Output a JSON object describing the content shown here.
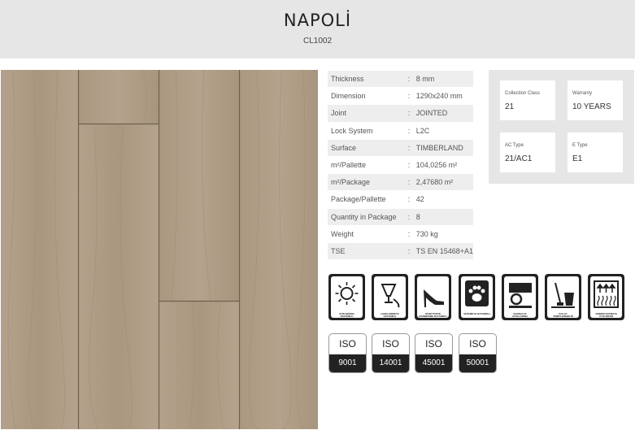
{
  "header": {
    "title": "NAPOLİ",
    "code": "CL1002"
  },
  "specs": [
    {
      "label": "Thickness",
      "sep": ":",
      "value": "8 mm"
    },
    {
      "label": "Dimension",
      "sep": ":",
      "value": "1290x240 mm"
    },
    {
      "label": "Joint",
      "sep": ":",
      "value": "JOINTED"
    },
    {
      "label": "Lock System",
      "sep": ":",
      "value": "L2C"
    },
    {
      "label": "Surface",
      "sep": ":",
      "value": "TIMBERLAND"
    },
    {
      "label": "m²/Pallette",
      "sep": ":",
      "value": "104,0256 m²"
    },
    {
      "label": "m²/Package",
      "sep": ":",
      "value": "2,47680 m²"
    },
    {
      "label": "Package/Pallette",
      "sep": ":",
      "value": "42"
    },
    {
      "label": "Quantity in Package",
      "sep": ":",
      "value": "8"
    },
    {
      "label": "Weight",
      "sep": ":",
      "value": "730 kg"
    },
    {
      "label": "TSE",
      "sep": ":",
      "value": "TS EN 15468+A1"
    }
  ],
  "info_cards": [
    {
      "label": "Collection Class",
      "value": "21"
    },
    {
      "label": "Warranty",
      "value": "10 YEARS"
    },
    {
      "label": "AC Type",
      "value": "21/AC1"
    },
    {
      "label": "E Type",
      "value": "E1"
    }
  ],
  "feature_icons": [
    {
      "icon": "sun-icon",
      "caption": "GÜN IŞIĞINA DAYANIKLI"
    },
    {
      "icon": "stain-resistant-icon",
      "caption": "LEKELENMEYE DAYANIKLI"
    },
    {
      "icon": "high-heel-icon",
      "caption": "SİVRİ TOPUK DARBESİNE DAYANIKLI"
    },
    {
      "icon": "paw-icon",
      "caption": "ÇİZİLMEYE DAYANIKLI"
    },
    {
      "icon": "chair-wheel-icon",
      "caption": "SANDALYE AYAKLARINA DAYANIKLI"
    },
    {
      "icon": "mop-bucket-icon",
      "caption": "KOLAY TEMİZLENEBİLİR"
    },
    {
      "icon": "underfloor-heating-icon",
      "caption": "YERDEN ISITMAYA UYGUNDUR"
    }
  ],
  "iso_badges": [
    {
      "top": "ISO",
      "number": "9001"
    },
    {
      "top": "ISO",
      "number": "14001"
    },
    {
      "top": "ISO",
      "number": "45001"
    },
    {
      "top": "ISO",
      "number": "50001"
    }
  ],
  "colors": {
    "header_bg": "#e6e6e6",
    "wood": "#b09e88",
    "icon_dark": "#222222",
    "row_alt": "#eeeeee"
  }
}
